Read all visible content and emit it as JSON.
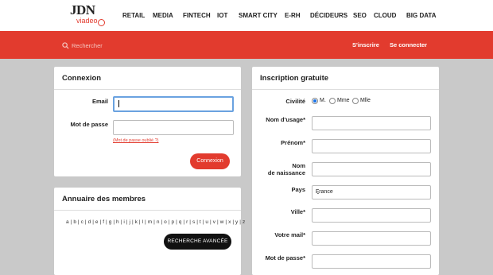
{
  "logo": {
    "top": "JDN",
    "bottom": "viadeo"
  },
  "nav": [
    "RETAIL",
    "MEDIA",
    "FINTECH",
    "IOT",
    "SMART CITY",
    "E-RH",
    "DÉCIDEURS",
    "SEO",
    "CLOUD",
    "BIG DATA"
  ],
  "searchbar": {
    "placeholder": "Rechercher",
    "signup": "S'inscrire",
    "login": "Se connecter"
  },
  "connexion": {
    "title": "Connexion",
    "email_label": "Email",
    "password_label": "Mot de passe",
    "forgot": "(Mot de passe oublié ?)",
    "submit": "Connexion"
  },
  "annuaire": {
    "title": "Annuaire des membres",
    "letters": "a | b | c | d | e | f | g | h | i | j | k | l | m | n | o | p | q | r | s | t | u | v | w | x | y | z",
    "advanced": "RECHERCHE AVANCÉE"
  },
  "inscription": {
    "title": "Inscription gratuite",
    "civilite_label": "Civilité",
    "civilite_options": [
      "M.",
      "Mme",
      "Mlle"
    ],
    "nom_usage_label": "Nom d'usage*",
    "prenom_label": "Prénom*",
    "nom_naissance_label_1": "Nom",
    "nom_naissance_label_2": "de naissance",
    "pays_label": "Pays",
    "pays_value": "France",
    "ville_label": "Ville*",
    "mail_label": "Votre mail*",
    "password_label": "Mot de passe*"
  },
  "colors": {
    "accent": "#e23b2e",
    "background": "#c9c9c9",
    "focus": "#6aa2e0"
  }
}
